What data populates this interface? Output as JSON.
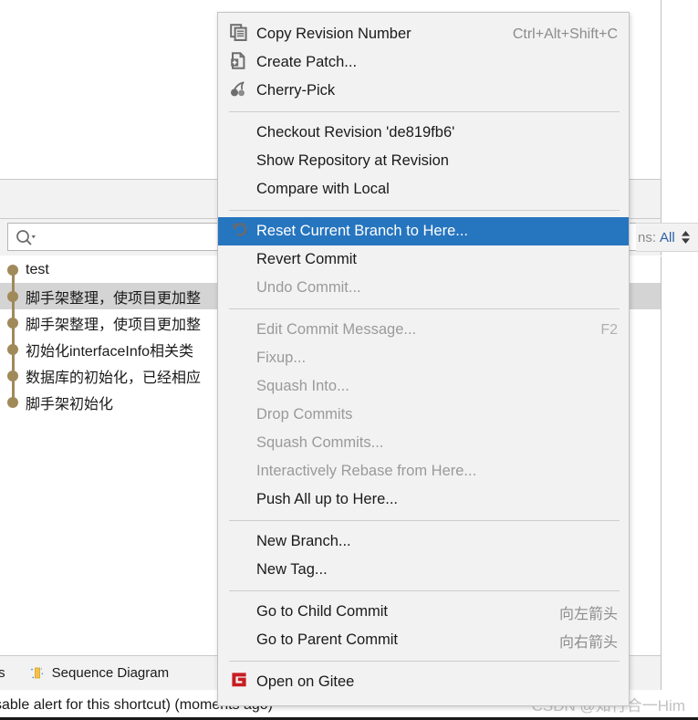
{
  "background": {
    "search": {
      "placeholder": "",
      "value": "",
      "icon": "search-icon"
    },
    "branch_filter": {
      "label": "ns:",
      "value": "All",
      "icon": "spinner-arrows-icon"
    },
    "commits": [
      {
        "subject": "test",
        "selected": false
      },
      {
        "subject": "脚手架整理，使项目更加整",
        "selected": true
      },
      {
        "subject": "脚手架整理，使项目更加整",
        "selected": false
      },
      {
        "subject": "初始化interfaceInfo相关类",
        "selected": false
      },
      {
        "subject": "数据库的初始化，已经相应",
        "selected": false
      },
      {
        "subject": "脚手架初始化",
        "selected": false
      }
    ],
    "bottom_tabs": {
      "commits_tab_partial": "ts",
      "sequence_diagram": "Sequence Diagram",
      "sequence_icon": "sequence-diagram-icon"
    },
    "status_text": "sable alert for this shortcut) (moments ago)",
    "watermark": "CSDN @知行合一Him"
  },
  "context_menu": {
    "groups": [
      {
        "items": [
          {
            "label": "Copy Revision Number",
            "accel": "Ctrl+Alt+Shift+C",
            "icon": "copy-icon",
            "state": "enabled"
          },
          {
            "label": "Create Patch...",
            "accel": "",
            "icon": "create-patch-icon",
            "state": "enabled"
          },
          {
            "label": "Cherry-Pick",
            "accel": "",
            "icon": "cherry-pick-icon",
            "state": "enabled"
          }
        ]
      },
      {
        "items": [
          {
            "label": "Checkout Revision 'de819fb6'",
            "accel": "",
            "icon": "",
            "state": "enabled"
          },
          {
            "label": "Show Repository at Revision",
            "accel": "",
            "icon": "",
            "state": "enabled"
          },
          {
            "label": "Compare with Local",
            "accel": "",
            "icon": "",
            "state": "enabled"
          }
        ]
      },
      {
        "items": [
          {
            "label": "Reset Current Branch to Here...",
            "accel": "",
            "icon": "reset-undo-icon",
            "state": "highlighted"
          },
          {
            "label": "Revert Commit",
            "accel": "",
            "icon": "",
            "state": "enabled"
          },
          {
            "label": "Undo Commit...",
            "accel": "",
            "icon": "",
            "state": "disabled"
          }
        ]
      },
      {
        "items": [
          {
            "label": "Edit Commit Message...",
            "accel": "F2",
            "icon": "",
            "state": "disabled"
          },
          {
            "label": "Fixup...",
            "accel": "",
            "icon": "",
            "state": "disabled"
          },
          {
            "label": "Squash Into...",
            "accel": "",
            "icon": "",
            "state": "disabled"
          },
          {
            "label": "Drop Commits",
            "accel": "",
            "icon": "",
            "state": "disabled"
          },
          {
            "label": "Squash Commits...",
            "accel": "",
            "icon": "",
            "state": "disabled"
          },
          {
            "label": "Interactively Rebase from Here...",
            "accel": "",
            "icon": "",
            "state": "disabled"
          },
          {
            "label": "Push All up to Here...",
            "accel": "",
            "icon": "",
            "state": "enabled"
          }
        ]
      },
      {
        "items": [
          {
            "label": "New Branch...",
            "accel": "",
            "icon": "",
            "state": "enabled"
          },
          {
            "label": "New Tag...",
            "accel": "",
            "icon": "",
            "state": "enabled"
          }
        ]
      },
      {
        "items": [
          {
            "label": "Go to Child Commit",
            "accel": "向左箭头",
            "icon": "",
            "state": "enabled"
          },
          {
            "label": "Go to Parent Commit",
            "accel": "向右箭头",
            "icon": "",
            "state": "enabled"
          }
        ]
      },
      {
        "items": [
          {
            "label": "Open on Gitee",
            "accel": "",
            "icon": "gitee-icon",
            "state": "enabled"
          }
        ]
      }
    ]
  },
  "colors": {
    "menu_bg": "#f2f2f2",
    "highlight": "#2675bf",
    "graph_node": "#a08a5a",
    "gitee_red": "#c71d23",
    "accent_blue": "#2b5fa8"
  }
}
